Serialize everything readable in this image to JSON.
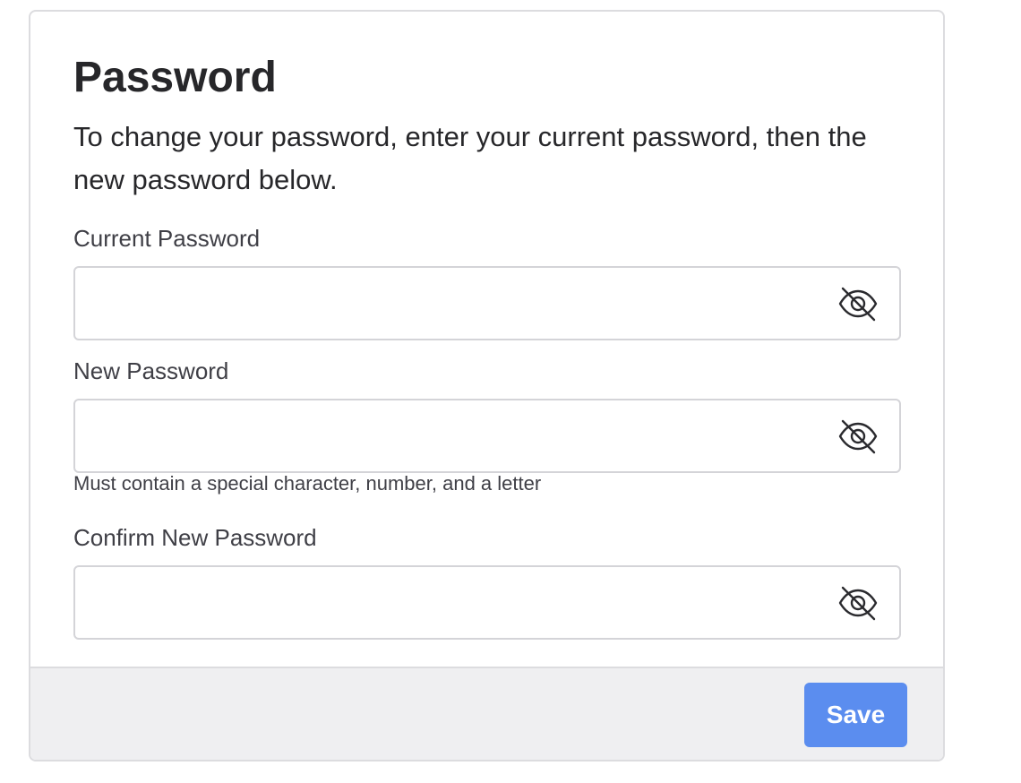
{
  "password_card": {
    "title": "Password",
    "description": "To change your password, enter your current password, then the new password below.",
    "fields": [
      {
        "label": "Current Password",
        "value": "",
        "placeholder": "",
        "visibility_icon": "eye-slash-icon"
      },
      {
        "label": "New Password",
        "value": "",
        "placeholder": "",
        "visibility_icon": "eye-slash-icon",
        "hint": "Must contain a special character, number, and a letter"
      },
      {
        "label": "Confirm New Password",
        "value": "",
        "placeholder": "",
        "visibility_icon": "eye-slash-icon"
      }
    ],
    "footer": {
      "save_label": "Save"
    }
  },
  "colors": {
    "accent": "#5b8def",
    "text": "#27272a",
    "footer_bg": "#efeff1",
    "border": "#d4d4d8"
  }
}
